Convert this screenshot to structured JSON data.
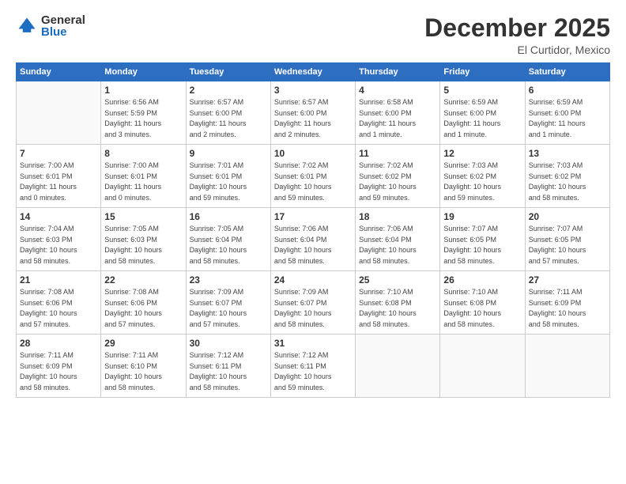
{
  "logo": {
    "general": "General",
    "blue": "Blue"
  },
  "title": "December 2025",
  "subtitle": "El Curtidor, Mexico",
  "header_days": [
    "Sunday",
    "Monday",
    "Tuesday",
    "Wednesday",
    "Thursday",
    "Friday",
    "Saturday"
  ],
  "weeks": [
    [
      {
        "day": "",
        "info": ""
      },
      {
        "day": "1",
        "info": "Sunrise: 6:56 AM\nSunset: 5:59 PM\nDaylight: 11 hours\nand 3 minutes."
      },
      {
        "day": "2",
        "info": "Sunrise: 6:57 AM\nSunset: 6:00 PM\nDaylight: 11 hours\nand 2 minutes."
      },
      {
        "day": "3",
        "info": "Sunrise: 6:57 AM\nSunset: 6:00 PM\nDaylight: 11 hours\nand 2 minutes."
      },
      {
        "day": "4",
        "info": "Sunrise: 6:58 AM\nSunset: 6:00 PM\nDaylight: 11 hours\nand 1 minute."
      },
      {
        "day": "5",
        "info": "Sunrise: 6:59 AM\nSunset: 6:00 PM\nDaylight: 11 hours\nand 1 minute."
      },
      {
        "day": "6",
        "info": "Sunrise: 6:59 AM\nSunset: 6:00 PM\nDaylight: 11 hours\nand 1 minute."
      }
    ],
    [
      {
        "day": "7",
        "info": "Sunrise: 7:00 AM\nSunset: 6:01 PM\nDaylight: 11 hours\nand 0 minutes."
      },
      {
        "day": "8",
        "info": "Sunrise: 7:00 AM\nSunset: 6:01 PM\nDaylight: 11 hours\nand 0 minutes."
      },
      {
        "day": "9",
        "info": "Sunrise: 7:01 AM\nSunset: 6:01 PM\nDaylight: 10 hours\nand 59 minutes."
      },
      {
        "day": "10",
        "info": "Sunrise: 7:02 AM\nSunset: 6:01 PM\nDaylight: 10 hours\nand 59 minutes."
      },
      {
        "day": "11",
        "info": "Sunrise: 7:02 AM\nSunset: 6:02 PM\nDaylight: 10 hours\nand 59 minutes."
      },
      {
        "day": "12",
        "info": "Sunrise: 7:03 AM\nSunset: 6:02 PM\nDaylight: 10 hours\nand 59 minutes."
      },
      {
        "day": "13",
        "info": "Sunrise: 7:03 AM\nSunset: 6:02 PM\nDaylight: 10 hours\nand 58 minutes."
      }
    ],
    [
      {
        "day": "14",
        "info": "Sunrise: 7:04 AM\nSunset: 6:03 PM\nDaylight: 10 hours\nand 58 minutes."
      },
      {
        "day": "15",
        "info": "Sunrise: 7:05 AM\nSunset: 6:03 PM\nDaylight: 10 hours\nand 58 minutes."
      },
      {
        "day": "16",
        "info": "Sunrise: 7:05 AM\nSunset: 6:04 PM\nDaylight: 10 hours\nand 58 minutes."
      },
      {
        "day": "17",
        "info": "Sunrise: 7:06 AM\nSunset: 6:04 PM\nDaylight: 10 hours\nand 58 minutes."
      },
      {
        "day": "18",
        "info": "Sunrise: 7:06 AM\nSunset: 6:04 PM\nDaylight: 10 hours\nand 58 minutes."
      },
      {
        "day": "19",
        "info": "Sunrise: 7:07 AM\nSunset: 6:05 PM\nDaylight: 10 hours\nand 58 minutes."
      },
      {
        "day": "20",
        "info": "Sunrise: 7:07 AM\nSunset: 6:05 PM\nDaylight: 10 hours\nand 57 minutes."
      }
    ],
    [
      {
        "day": "21",
        "info": "Sunrise: 7:08 AM\nSunset: 6:06 PM\nDaylight: 10 hours\nand 57 minutes."
      },
      {
        "day": "22",
        "info": "Sunrise: 7:08 AM\nSunset: 6:06 PM\nDaylight: 10 hours\nand 57 minutes."
      },
      {
        "day": "23",
        "info": "Sunrise: 7:09 AM\nSunset: 6:07 PM\nDaylight: 10 hours\nand 57 minutes."
      },
      {
        "day": "24",
        "info": "Sunrise: 7:09 AM\nSunset: 6:07 PM\nDaylight: 10 hours\nand 58 minutes."
      },
      {
        "day": "25",
        "info": "Sunrise: 7:10 AM\nSunset: 6:08 PM\nDaylight: 10 hours\nand 58 minutes."
      },
      {
        "day": "26",
        "info": "Sunrise: 7:10 AM\nSunset: 6:08 PM\nDaylight: 10 hours\nand 58 minutes."
      },
      {
        "day": "27",
        "info": "Sunrise: 7:11 AM\nSunset: 6:09 PM\nDaylight: 10 hours\nand 58 minutes."
      }
    ],
    [
      {
        "day": "28",
        "info": "Sunrise: 7:11 AM\nSunset: 6:09 PM\nDaylight: 10 hours\nand 58 minutes."
      },
      {
        "day": "29",
        "info": "Sunrise: 7:11 AM\nSunset: 6:10 PM\nDaylight: 10 hours\nand 58 minutes."
      },
      {
        "day": "30",
        "info": "Sunrise: 7:12 AM\nSunset: 6:11 PM\nDaylight: 10 hours\nand 58 minutes."
      },
      {
        "day": "31",
        "info": "Sunrise: 7:12 AM\nSunset: 6:11 PM\nDaylight: 10 hours\nand 59 minutes."
      },
      {
        "day": "",
        "info": ""
      },
      {
        "day": "",
        "info": ""
      },
      {
        "day": "",
        "info": ""
      }
    ]
  ]
}
